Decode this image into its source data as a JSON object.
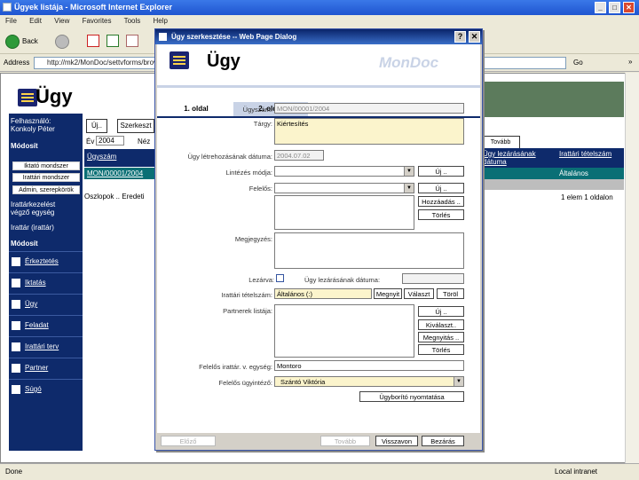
{
  "ie": {
    "title": "Ügyek listája - Microsoft Internet Explorer",
    "menu": [
      "File",
      "Edit",
      "View",
      "Favorites",
      "Tools",
      "Help"
    ],
    "back_label": "Back",
    "address_label": "Address",
    "address_value": "http://mk2/MonDoc/settvforms/brov",
    "go_label": "Go",
    "links_label": "»",
    "status_text": "Done",
    "zone_text": "Local intranet"
  },
  "page": {
    "title": "Ügy",
    "user_label": "Felhasználó:",
    "user_name": "Konkoly Péter",
    "modosit": "Módosít",
    "nav_buttons": [
      "Iktató mondszer",
      "Irattári mondszer",
      "Admin, szerepkörök"
    ],
    "nav_texts": [
      "Irattárkezelést",
      "végző egység",
      "Irattár (irattár)"
    ],
    "modosit2": "Módosít",
    "nav_items": [
      "Érkeztetés",
      "Iktatás",
      "Ügy",
      "Feladat",
      "Irattári terv",
      "Partner",
      "Súgó"
    ],
    "mid_buttons": [
      "Új..",
      "Szerkeszt"
    ],
    "ev_label": "Év",
    "ev_value": "2004",
    "nezet_label": "Néz",
    "grid_head_label": "Ügyszám",
    "grid_row_value": "MON/00001/2004",
    "oszlopok_label": "Oszlopok ..  Eredeti",
    "right_head": [
      "Ügy lezárásának dátuma",
      "Irattári tételszám"
    ],
    "right_row": "Általános",
    "pager": "1 elem 1 oldalon",
    "right_btn": "Tovább"
  },
  "dialog": {
    "title": "Ügy szerkesztése -- Web Page Dialog",
    "logo_text": "Ügy",
    "brand": "MonDoc",
    "tabs": [
      "1. oldal",
      "2. oldal"
    ],
    "fields": {
      "ugyszam_label": "Ügyszám:",
      "ugyszam_value": "MON/00001/2004",
      "targy_label": "Tárgy:",
      "targy_value": "Kiértesítés",
      "datum_label": "Ügy létrehozásának dátuma:",
      "datum_value": "2004.07.02",
      "mod_label": "Lintézés módja:",
      "felelos_label": "Felelős:",
      "megj_label": "Megjegyzés:",
      "lezarva_label": "Lezárva:",
      "lezaras_label": "Ügy lezárásának dátuma:",
      "irattari_label": "Irattári tételszám:",
      "irattari_value": "Általános (:)",
      "partner_label": "Partnerek listája:",
      "egyseg_label": "Felelős irattár. v. egység:",
      "egyseg_value": "Montoro",
      "ugyintezo_label": "Felelős ügyintéző:",
      "ugyintezo_value": "Szántó Viktória"
    },
    "buttons": {
      "uj1": "Új ..",
      "uj2": "Új ..",
      "hozzaadas": "Hozzáadás ..",
      "torles1": "Törlés",
      "megnyit": "Megnyit",
      "valaszt": "Választ",
      "torol": "Töröl",
      "uj3": "Új ..",
      "kivalaszt": "Kiválaszt..",
      "megnyites": "Megnyitás ..",
      "torles2": "Törlés",
      "nyomtat": "Ügyborító nyomtatása",
      "elozo": "Előző",
      "tovabb": "Tovább",
      "vissza": "Visszavon",
      "bezaras": "Bezárás"
    }
  }
}
